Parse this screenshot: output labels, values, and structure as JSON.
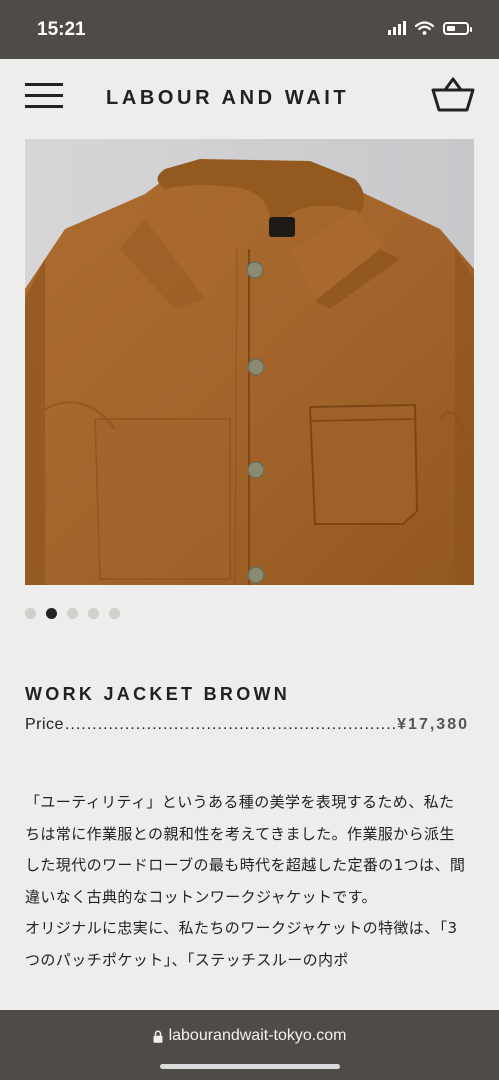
{
  "status": {
    "time": "15:21",
    "signal_icon": "cellular-signal-icon",
    "wifi_icon": "wifi-icon",
    "battery_icon": "battery-icon",
    "battery_level": 0.45
  },
  "header": {
    "brand": "LABOUR AND WAIT",
    "menu_icon": "hamburger-menu-icon",
    "cart_icon": "shopping-basket-icon"
  },
  "gallery": {
    "image": "brown-work-jacket-photo",
    "slide_count": 5,
    "active_slide": 2
  },
  "product": {
    "name": "WORK JACKET BROWN",
    "price_label": "Price",
    "price_leader": ".........................................................................",
    "price": "¥17,380"
  },
  "description": {
    "p1": "「ユーティリティ」というある種の美学を表現するため、私たちは常に作業服との親和性を考えてきました。作業服から派生した現代のワードローブの最も時代を超越した定番の1つは、間違いなく古典的なコットンワークジャケットです。",
    "p2": "オリジナルに忠実に、私たちのワークジャケットの特徴は、「3つのパッチポケット」、「ステッチスルーの内ポ"
  },
  "browser": {
    "url": "labourandwait-tokyo.com",
    "lock_icon": "lock-icon"
  },
  "colors": {
    "system_bar": "#4f4b47",
    "page_bg": "#ededeb",
    "jacket": "#a2652b",
    "text": "#222222"
  }
}
